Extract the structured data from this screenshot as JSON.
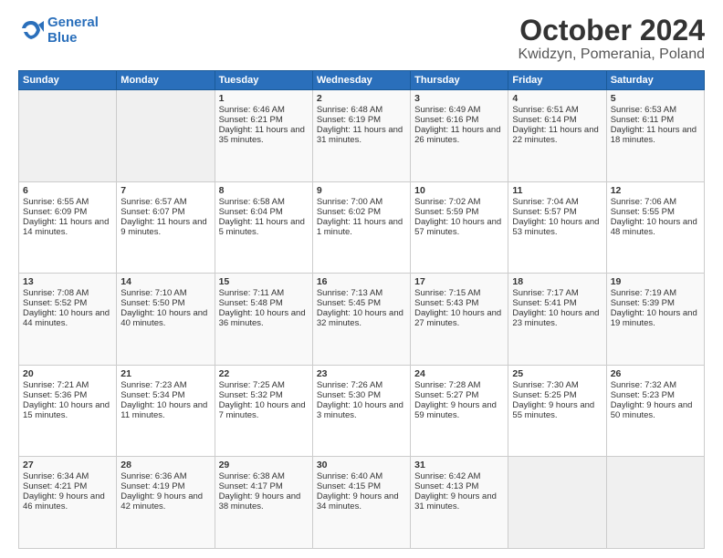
{
  "header": {
    "logo_line1": "General",
    "logo_line2": "Blue",
    "title": "October 2024",
    "subtitle": "Kwidzyn, Pomerania, Poland"
  },
  "days_of_week": [
    "Sunday",
    "Monday",
    "Tuesday",
    "Wednesday",
    "Thursday",
    "Friday",
    "Saturday"
  ],
  "weeks": [
    [
      {
        "day": "",
        "sunrise": "",
        "sunset": "",
        "daylight": "",
        "empty": true
      },
      {
        "day": "",
        "sunrise": "",
        "sunset": "",
        "daylight": "",
        "empty": true
      },
      {
        "day": "1",
        "sunrise": "Sunrise: 6:46 AM",
        "sunset": "Sunset: 6:21 PM",
        "daylight": "Daylight: 11 hours and 35 minutes."
      },
      {
        "day": "2",
        "sunrise": "Sunrise: 6:48 AM",
        "sunset": "Sunset: 6:19 PM",
        "daylight": "Daylight: 11 hours and 31 minutes."
      },
      {
        "day": "3",
        "sunrise": "Sunrise: 6:49 AM",
        "sunset": "Sunset: 6:16 PM",
        "daylight": "Daylight: 11 hours and 26 minutes."
      },
      {
        "day": "4",
        "sunrise": "Sunrise: 6:51 AM",
        "sunset": "Sunset: 6:14 PM",
        "daylight": "Daylight: 11 hours and 22 minutes."
      },
      {
        "day": "5",
        "sunrise": "Sunrise: 6:53 AM",
        "sunset": "Sunset: 6:11 PM",
        "daylight": "Daylight: 11 hours and 18 minutes."
      }
    ],
    [
      {
        "day": "6",
        "sunrise": "Sunrise: 6:55 AM",
        "sunset": "Sunset: 6:09 PM",
        "daylight": "Daylight: 11 hours and 14 minutes."
      },
      {
        "day": "7",
        "sunrise": "Sunrise: 6:57 AM",
        "sunset": "Sunset: 6:07 PM",
        "daylight": "Daylight: 11 hours and 9 minutes."
      },
      {
        "day": "8",
        "sunrise": "Sunrise: 6:58 AM",
        "sunset": "Sunset: 6:04 PM",
        "daylight": "Daylight: 11 hours and 5 minutes."
      },
      {
        "day": "9",
        "sunrise": "Sunrise: 7:00 AM",
        "sunset": "Sunset: 6:02 PM",
        "daylight": "Daylight: 11 hours and 1 minute."
      },
      {
        "day": "10",
        "sunrise": "Sunrise: 7:02 AM",
        "sunset": "Sunset: 5:59 PM",
        "daylight": "Daylight: 10 hours and 57 minutes."
      },
      {
        "day": "11",
        "sunrise": "Sunrise: 7:04 AM",
        "sunset": "Sunset: 5:57 PM",
        "daylight": "Daylight: 10 hours and 53 minutes."
      },
      {
        "day": "12",
        "sunrise": "Sunrise: 7:06 AM",
        "sunset": "Sunset: 5:55 PM",
        "daylight": "Daylight: 10 hours and 48 minutes."
      }
    ],
    [
      {
        "day": "13",
        "sunrise": "Sunrise: 7:08 AM",
        "sunset": "Sunset: 5:52 PM",
        "daylight": "Daylight: 10 hours and 44 minutes."
      },
      {
        "day": "14",
        "sunrise": "Sunrise: 7:10 AM",
        "sunset": "Sunset: 5:50 PM",
        "daylight": "Daylight: 10 hours and 40 minutes."
      },
      {
        "day": "15",
        "sunrise": "Sunrise: 7:11 AM",
        "sunset": "Sunset: 5:48 PM",
        "daylight": "Daylight: 10 hours and 36 minutes."
      },
      {
        "day": "16",
        "sunrise": "Sunrise: 7:13 AM",
        "sunset": "Sunset: 5:45 PM",
        "daylight": "Daylight: 10 hours and 32 minutes."
      },
      {
        "day": "17",
        "sunrise": "Sunrise: 7:15 AM",
        "sunset": "Sunset: 5:43 PM",
        "daylight": "Daylight: 10 hours and 27 minutes."
      },
      {
        "day": "18",
        "sunrise": "Sunrise: 7:17 AM",
        "sunset": "Sunset: 5:41 PM",
        "daylight": "Daylight: 10 hours and 23 minutes."
      },
      {
        "day": "19",
        "sunrise": "Sunrise: 7:19 AM",
        "sunset": "Sunset: 5:39 PM",
        "daylight": "Daylight: 10 hours and 19 minutes."
      }
    ],
    [
      {
        "day": "20",
        "sunrise": "Sunrise: 7:21 AM",
        "sunset": "Sunset: 5:36 PM",
        "daylight": "Daylight: 10 hours and 15 minutes."
      },
      {
        "day": "21",
        "sunrise": "Sunrise: 7:23 AM",
        "sunset": "Sunset: 5:34 PM",
        "daylight": "Daylight: 10 hours and 11 minutes."
      },
      {
        "day": "22",
        "sunrise": "Sunrise: 7:25 AM",
        "sunset": "Sunset: 5:32 PM",
        "daylight": "Daylight: 10 hours and 7 minutes."
      },
      {
        "day": "23",
        "sunrise": "Sunrise: 7:26 AM",
        "sunset": "Sunset: 5:30 PM",
        "daylight": "Daylight: 10 hours and 3 minutes."
      },
      {
        "day": "24",
        "sunrise": "Sunrise: 7:28 AM",
        "sunset": "Sunset: 5:27 PM",
        "daylight": "Daylight: 9 hours and 59 minutes."
      },
      {
        "day": "25",
        "sunrise": "Sunrise: 7:30 AM",
        "sunset": "Sunset: 5:25 PM",
        "daylight": "Daylight: 9 hours and 55 minutes."
      },
      {
        "day": "26",
        "sunrise": "Sunrise: 7:32 AM",
        "sunset": "Sunset: 5:23 PM",
        "daylight": "Daylight: 9 hours and 50 minutes."
      }
    ],
    [
      {
        "day": "27",
        "sunrise": "Sunrise: 6:34 AM",
        "sunset": "Sunset: 4:21 PM",
        "daylight": "Daylight: 9 hours and 46 minutes."
      },
      {
        "day": "28",
        "sunrise": "Sunrise: 6:36 AM",
        "sunset": "Sunset: 4:19 PM",
        "daylight": "Daylight: 9 hours and 42 minutes."
      },
      {
        "day": "29",
        "sunrise": "Sunrise: 6:38 AM",
        "sunset": "Sunset: 4:17 PM",
        "daylight": "Daylight: 9 hours and 38 minutes."
      },
      {
        "day": "30",
        "sunrise": "Sunrise: 6:40 AM",
        "sunset": "Sunset: 4:15 PM",
        "daylight": "Daylight: 9 hours and 34 minutes."
      },
      {
        "day": "31",
        "sunrise": "Sunrise: 6:42 AM",
        "sunset": "Sunset: 4:13 PM",
        "daylight": "Daylight: 9 hours and 31 minutes."
      },
      {
        "day": "",
        "sunrise": "",
        "sunset": "",
        "daylight": "",
        "empty": true
      },
      {
        "day": "",
        "sunrise": "",
        "sunset": "",
        "daylight": "",
        "empty": true
      }
    ]
  ]
}
